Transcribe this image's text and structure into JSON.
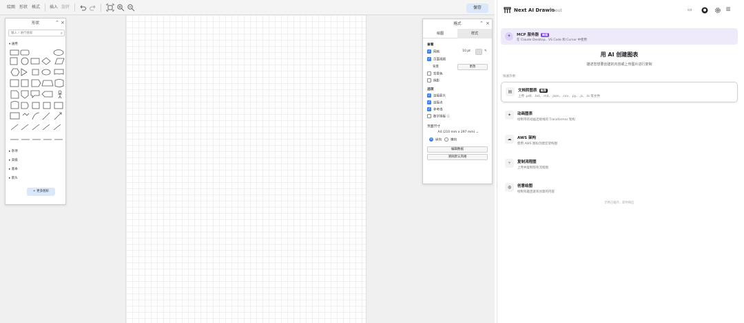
{
  "toolbar": {
    "menu": [
      "绘图",
      "形状",
      "格式"
    ],
    "insert": "插入",
    "rotate": "旋转",
    "save": "保存"
  },
  "shapes": {
    "title": "形状",
    "search_placeholder": "输入 / 进行搜索",
    "general": "通用",
    "categories": [
      "杂项",
      "高级",
      "基本",
      "箭头"
    ],
    "more": "更多图形"
  },
  "format": {
    "title": "格式",
    "tabs": [
      "绘图",
      "样式"
    ],
    "sections": {
      "view": "查看",
      "options": "选项",
      "paper": "页面尺寸"
    },
    "view_items": [
      {
        "label": "网格",
        "checked": true
      },
      {
        "label": "页面视图",
        "checked": true
      },
      {
        "label": "背景色",
        "checked": false
      },
      {
        "label": "阴影",
        "checked": false
      }
    ],
    "grid_size": "10 pt",
    "background_label": "背景",
    "change": "更改",
    "option_items": [
      {
        "label": "连接箭头",
        "checked": true
      },
      {
        "label": "连接点",
        "checked": true
      },
      {
        "label": "参考线",
        "checked": true
      },
      {
        "label": "数学排版",
        "checked": false
      }
    ],
    "paper_size": "A4 (210 mm x 297 mm)",
    "portrait": "纵向",
    "landscape": "横向",
    "edit_data": "编辑数据",
    "clear_default_style": "清除默认风格"
  },
  "sidebar": {
    "brand": "Next AI Drawio",
    "about": "About",
    "mcp": {
      "title": "MCP 服务器",
      "badge": "新版",
      "desc": "在 Claude Desktop、VS Code 和 Cursor 中使用"
    },
    "heading": "用 AI 创建图表",
    "subheading": "描述您想要创建的内容或上传图片进行复制",
    "quick_label": "快速示例",
    "examples": [
      {
        "title": "文档转图表",
        "badge": "推荐",
        "desc": "上传 .pdf、.txt、.md、.json、.csv、.py、.js、.ts 等文件",
        "icon": "document-icon"
      },
      {
        "title": "动画图表",
        "desc": "绘制带有动画连接线的 Transformer 架构",
        "icon": "sparkle-icon"
      },
      {
        "title": "AWS 架构",
        "desc": "使用 AWS 图标创建云架构图",
        "icon": "cloud-icon"
      },
      {
        "title": "复制流程图",
        "desc": "上传并复制现有流程图",
        "icon": "flow-icon"
      },
      {
        "title": "创意绘图",
        "desc": "绘制有趣且富有创意的内容",
        "icon": "palette-icon"
      }
    ],
    "footer": "示例已缓存，即时响应",
    "colors": {
      "accent": "#3b82f6",
      "badge_purple": "#7c3aed",
      "badge_dark": "#222222"
    }
  }
}
